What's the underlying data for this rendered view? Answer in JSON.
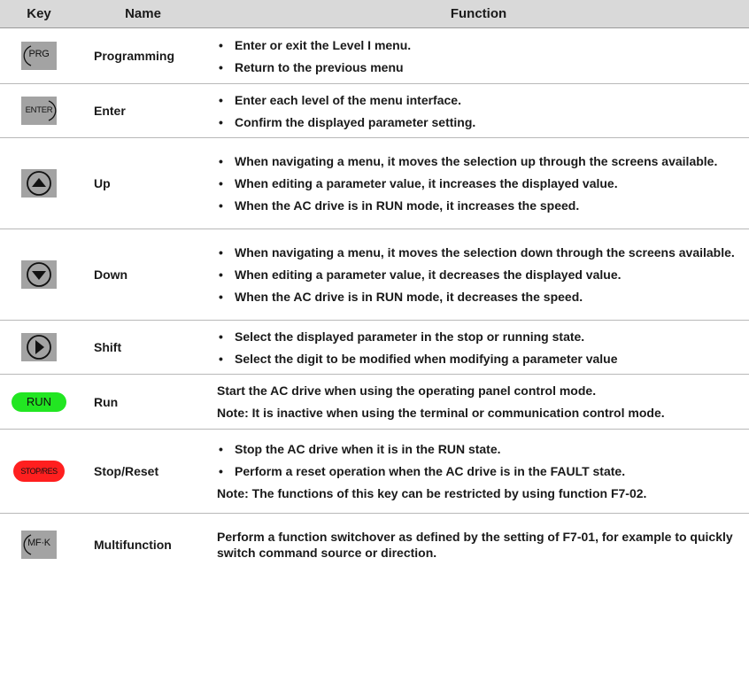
{
  "headers": {
    "key": "Key",
    "name": "Name",
    "function": "Function"
  },
  "colors": {
    "header_bg": "#d9d9d9",
    "key_bg": "#a3a3a3",
    "run": "#22e622",
    "stop": "#ff1f1f"
  },
  "rows": [
    {
      "key_label": "PRG",
      "key_icon": "prg-key-icon",
      "name": "Programming",
      "bullets": [
        "Enter or exit the Level I menu.",
        "Return to the previous menu"
      ]
    },
    {
      "key_label": "ENTER",
      "key_icon": "enter-key-icon",
      "name": "Enter",
      "bullets": [
        "Enter each level of the menu interface.",
        "Confirm the displayed parameter setting."
      ]
    },
    {
      "key_label": "",
      "key_icon": "up-arrow-icon",
      "name": "Up",
      "bullets": [
        "When navigating a menu, it moves the selection up through the screens available.",
        "When editing a parameter value, it increases the displayed value.",
        "When the AC drive is in RUN mode, it increases the speed."
      ]
    },
    {
      "key_label": "",
      "key_icon": "down-arrow-icon",
      "name": "Down",
      "bullets": [
        "When navigating a menu, it moves the selection down through the screens available.",
        "When editing a parameter value, it decreases the displayed value.",
        "When the AC drive is in RUN mode, it decreases the speed."
      ]
    },
    {
      "key_label": "",
      "key_icon": "right-arrow-icon",
      "name": "Shift",
      "bullets": [
        "Select the displayed parameter in the stop or running state.",
        "Select the digit to be modified when modifying a parameter value"
      ]
    },
    {
      "key_label": "RUN",
      "key_icon": "run-key-icon",
      "name": "Run",
      "lines": [
        "Start the AC drive when using the operating panel control mode.",
        "Note: It is inactive when using the terminal or communication control mode."
      ]
    },
    {
      "key_label": "STOP/RES",
      "key_icon": "stop-reset-key-icon",
      "name": "Stop/Reset",
      "bullets": [
        "Stop the AC drive when it is in the RUN state.",
        "Perform a reset operation when the AC drive is in the FAULT state."
      ],
      "note": "Note: The functions of this key can be restricted by using function F7-02."
    },
    {
      "key_label": "MF·K",
      "key_icon": "mf-k-key-icon",
      "name": "Multifunction",
      "lines": [
        "Perform a function switchover as defined by the setting of F7-01, for example to quickly switch command source or direction."
      ]
    }
  ]
}
